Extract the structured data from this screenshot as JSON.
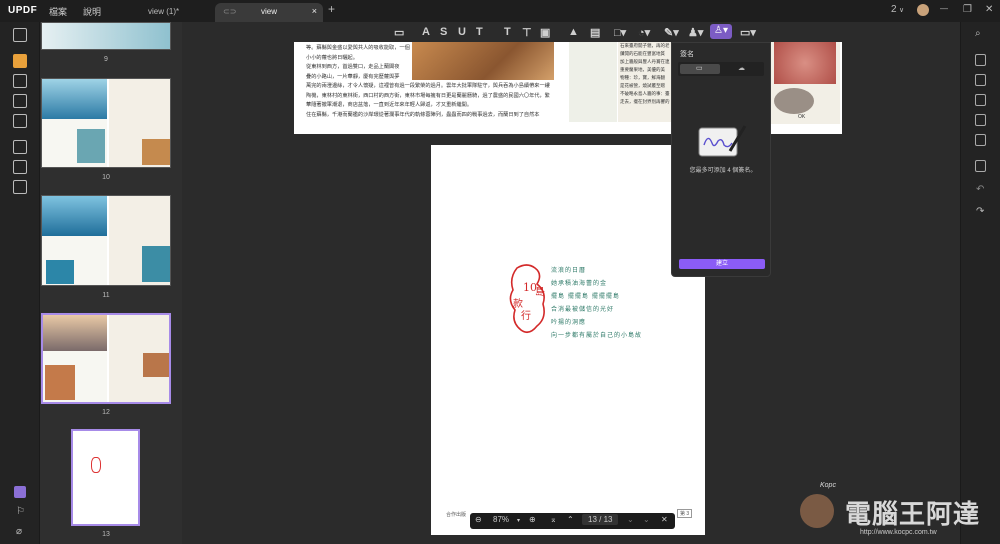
{
  "app": {
    "logo": "UPDF",
    "menu": [
      "檔案",
      "說明"
    ]
  },
  "tabs": [
    {
      "label": "view (1)*"
    },
    {
      "label": "view"
    }
  ],
  "tab_add": "+",
  "tab_close": "×",
  "titlebar_right": {
    "count": "2",
    "chevron": "∨",
    "minimize": "—",
    "restore": "❐",
    "close": "✕"
  },
  "thumbnails": [
    {
      "num": "9"
    },
    {
      "num": "10"
    },
    {
      "num": "11"
    },
    {
      "num": "12"
    },
    {
      "num": "13"
    }
  ],
  "top_page": {
    "text": [
      "等。蘇縣與金盛以愛與共人的吸收能取，一個",
      "小小的蘿也將日曬起。",
      "從東林到西方，首過雙口，走品上蘭閣夜",
      "疊的小路山，一片華靜，慶有完歷蘿與夢",
      "萬完的兩澄邊絲，才令人懷疑，這裡曾有過一段繁榮的過月。雲年大批軍隊駐守，與兵吞為小島續帶來一縷",
      "陶機，東林村的東林街，西口村的西方街，東林市場每擁有日更是蘭麗曆騎，過了農盛的民國六〇年代，繁",
      "華隨著撤軍潮退，商店盆落，一直到近年來年輕人歸返，才又重新繼開。",
      "住在蘇縣，千港而蘭艦的沙岸環從著瀾事年代的軌條蓉陣列，蟲蟲而四的戰事過去，而蘭日到了自然本"
    ],
    "right_text": [
      "石來臺府開子親，再的老",
      "鑽開的石能在豐富地質",
      "加上牆般與豐人丹賞在連",
      "重要蘭果地，美優的美",
      "物種：珍，寶，鮮海翻",
      "是花被營，燒試叢至贈",
      "不破略永島人牆的事：臺",
      "走去，擺在封界別再響的"
    ],
    "ok": "OK"
  },
  "page13": {
    "stamp_text": [
      "10",
      "島",
      "款",
      "行"
    ],
    "poem": [
      "流浪的日曆",
      "她承積油海蕾的金",
      "擺島 擺擺島 擺擺擺島",
      "合消最被儲信的光好",
      "吟揚的洞應",
      "向一步都有屬於自己的小島故",
      "與"
    ],
    "footer_left": "合作出版",
    "footer_right": "第 3"
  },
  "signature_panel": {
    "title": "簽名",
    "message": "您最多可添加 4 個簽名。",
    "add_button": "建立",
    "colors": {
      "accent": "#a78be8",
      "button": "#8b5cf6"
    }
  },
  "bottom_bar": {
    "zoom_out": "⊖",
    "zoom": "87%",
    "zoom_arrow": "▾",
    "zoom_in": "⊕",
    "first": "⌅",
    "prev": "⌃",
    "page_indicator": "13 / 13",
    "next": "⌄",
    "last": "⌄",
    "close": "✕"
  },
  "watermark": {
    "text": "電腦王阿達",
    "url": "http://www.kocpc.com.tw",
    "signature": "Kopc"
  }
}
